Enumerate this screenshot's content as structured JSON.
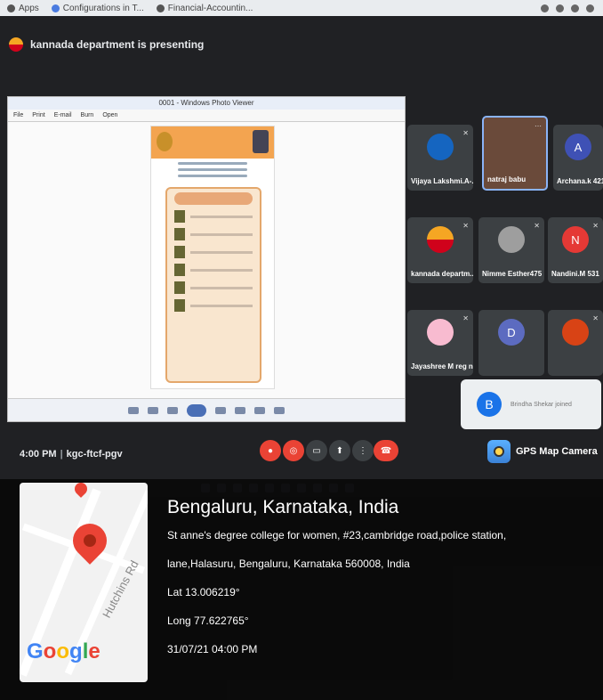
{
  "bookmarks": {
    "items": [
      {
        "label": "Apps"
      },
      {
        "label": "Configurations in T..."
      },
      {
        "label": "Financial-Accountin..."
      }
    ]
  },
  "meet": {
    "presenting_banner": "kannada department is presenting",
    "viewer": {
      "title": "0001 - Windows Photo Viewer",
      "menu": [
        "File",
        "Print",
        "E-mail",
        "Burn",
        "Open"
      ]
    },
    "tiles": [
      {
        "name": "Vijaya Lakshmi.A-...",
        "initial": "",
        "color": "#1565c0"
      },
      {
        "name": "natraj babu",
        "initial": "",
        "color": "#6a4a3a"
      },
      {
        "name": "Archana.k 421",
        "initial": "A",
        "color": "#3f51b5"
      },
      {
        "name": "kannada departm...",
        "initial": "",
        "color": "#f5a623"
      },
      {
        "name": "Nimme Esther475",
        "initial": "",
        "color": "#9e9e9e"
      },
      {
        "name": "Nandini.M 531",
        "initial": "N",
        "color": "#e53935"
      },
      {
        "name": "Jayashree M reg n...",
        "initial": "",
        "color": "#c2185b"
      },
      {
        "name": "",
        "initial": "D",
        "color": "#5c6bc0"
      },
      {
        "name": "",
        "initial": "",
        "color": "#d84315"
      }
    ],
    "meeting_time": "4:00 PM",
    "meeting_code": "kgc-ftcf-pgv",
    "popup": {
      "initial": "B",
      "text": "Brindha Shekar joined"
    }
  },
  "gps_badge": {
    "label": "GPS Map Camera"
  },
  "overlay": {
    "city": "Bengaluru, Karnataka, India",
    "address_line1": "St anne's degree college for women, #23,cambridge road,police station,",
    "address_line2": "lane,Halasuru, Bengaluru, Karnataka 560008, India",
    "lat": "Lat 13.006219°",
    "long": "Long 77.622765°",
    "datetime": "31/07/21 04:00 PM",
    "map_road": "Hutchins Rd",
    "map_logo": {
      "g1": "G",
      "o1": "o",
      "o2": "o",
      "g2": "g",
      "l": "l",
      "e": "e"
    }
  }
}
